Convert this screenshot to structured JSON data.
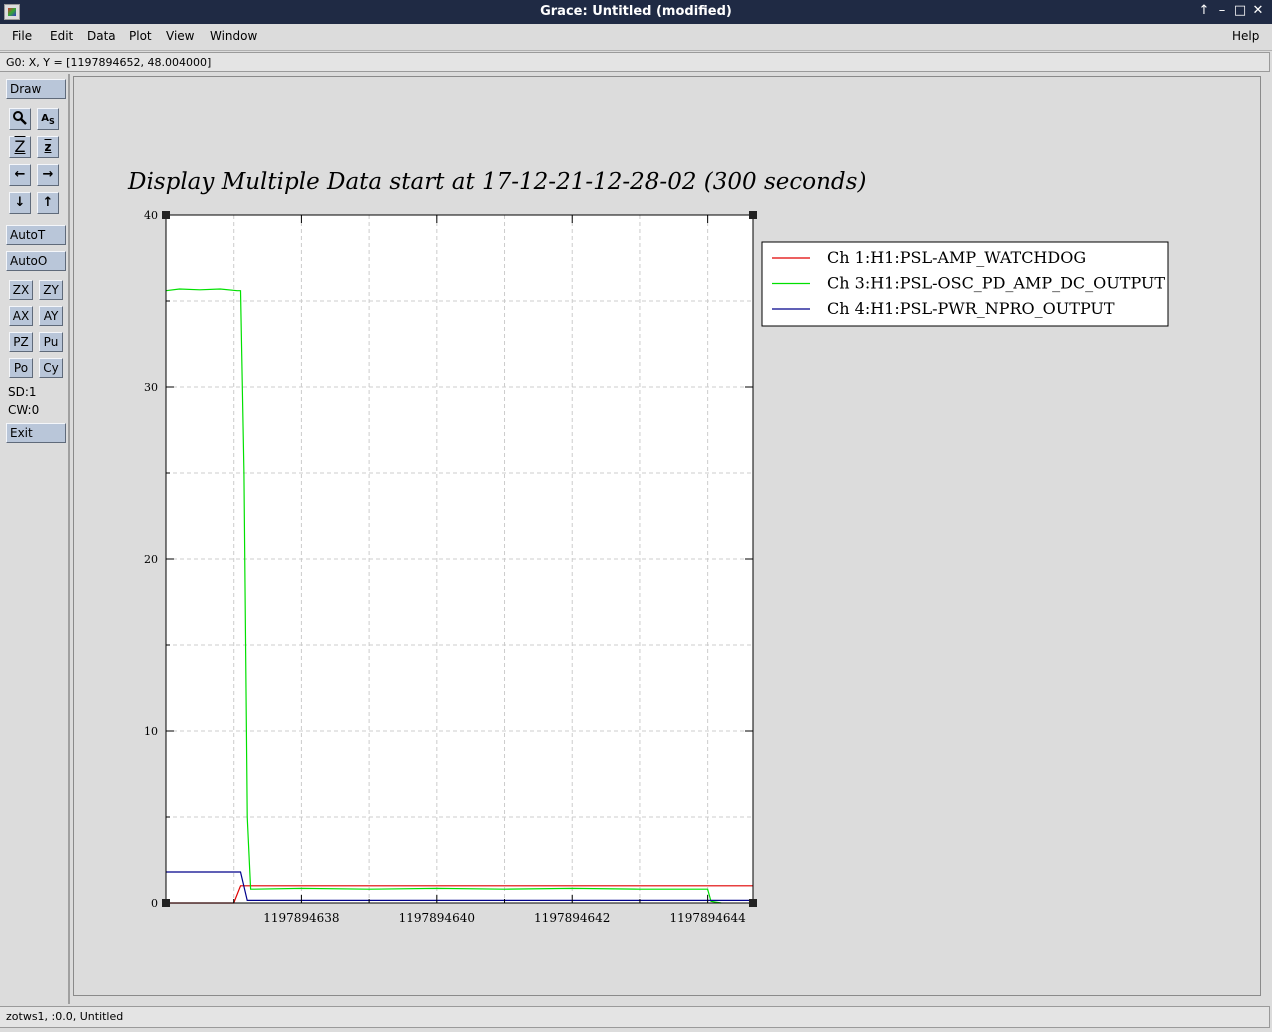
{
  "window": {
    "title": "Grace: Untitled (modified)",
    "controls": [
      "↑",
      "–",
      "□",
      "✕"
    ]
  },
  "menu": {
    "file": "File",
    "edit": "Edit",
    "data": "Data",
    "plot": "Plot",
    "view": "View",
    "window": "Window",
    "help": "Help"
  },
  "locator": "G0: X, Y = [1197894652, 48.004000]",
  "toolbar": {
    "draw": "Draw",
    "autot": "AutoT",
    "autoo": "AutoO",
    "zx": "ZX",
    "zy": "ZY",
    "ax": "AX",
    "ay": "AY",
    "pz": "PZ",
    "pu": "Pu",
    "po": "Po",
    "cy": "Cy",
    "sd": "SD:1",
    "cw": "CW:0",
    "exit": "Exit"
  },
  "status": "zotws1, :0.0, Untitled",
  "chart_data": {
    "type": "line",
    "title": "Display Multiple Data start at 17-12-21-12-28-02 (300 seconds)",
    "xlim": [
      1197894636,
      1197894644.67
    ],
    "ylim": [
      0,
      40
    ],
    "xticks": [
      1197894638,
      1197894640,
      1197894642,
      1197894644
    ],
    "xtick_labels": [
      "1197894638",
      "1197894640",
      "1197894642",
      "1197894644"
    ],
    "yticks": [
      0,
      10,
      20,
      30,
      40
    ],
    "ytick_labels": [
      "0",
      "10",
      "20",
      "30",
      "40"
    ],
    "grid": true,
    "legend_position": "right",
    "series": [
      {
        "name": "Ch 1:H1:PSL-AMP_WATCHDOG",
        "color": "#e00000",
        "x": [
          1197894636,
          1197894637.0,
          1197894637.1,
          1197894644.67
        ],
        "y": [
          0,
          0,
          1,
          1
        ]
      },
      {
        "name": "Ch 3:H1:PSL-OSC_PD_AMP_DC_OUTPUT",
        "color": "#00e000",
        "x": [
          1197894636,
          1197894636.2,
          1197894636.5,
          1197894636.8,
          1197894637.05,
          1197894637.1,
          1197894637.15,
          1197894637.2,
          1197894637.25,
          1197894637.3,
          1197894638,
          1197894639,
          1197894640,
          1197894641,
          1197894642,
          1197894643,
          1197894644,
          1197894644.05,
          1197894644.2
        ],
        "y": [
          35.6,
          35.7,
          35.65,
          35.7,
          35.6,
          35.6,
          25,
          5,
          0.8,
          0.8,
          0.85,
          0.8,
          0.85,
          0.8,
          0.85,
          0.8,
          0.8,
          0.1,
          0
        ]
      },
      {
        "name": "Ch 4:H1:PSL-PWR_NPRO_OUTPUT",
        "color": "#00008b",
        "x": [
          1197894636,
          1197894637.1,
          1197894637.2,
          1197894644.67
        ],
        "y": [
          1.8,
          1.8,
          0.15,
          0.15
        ]
      }
    ]
  }
}
